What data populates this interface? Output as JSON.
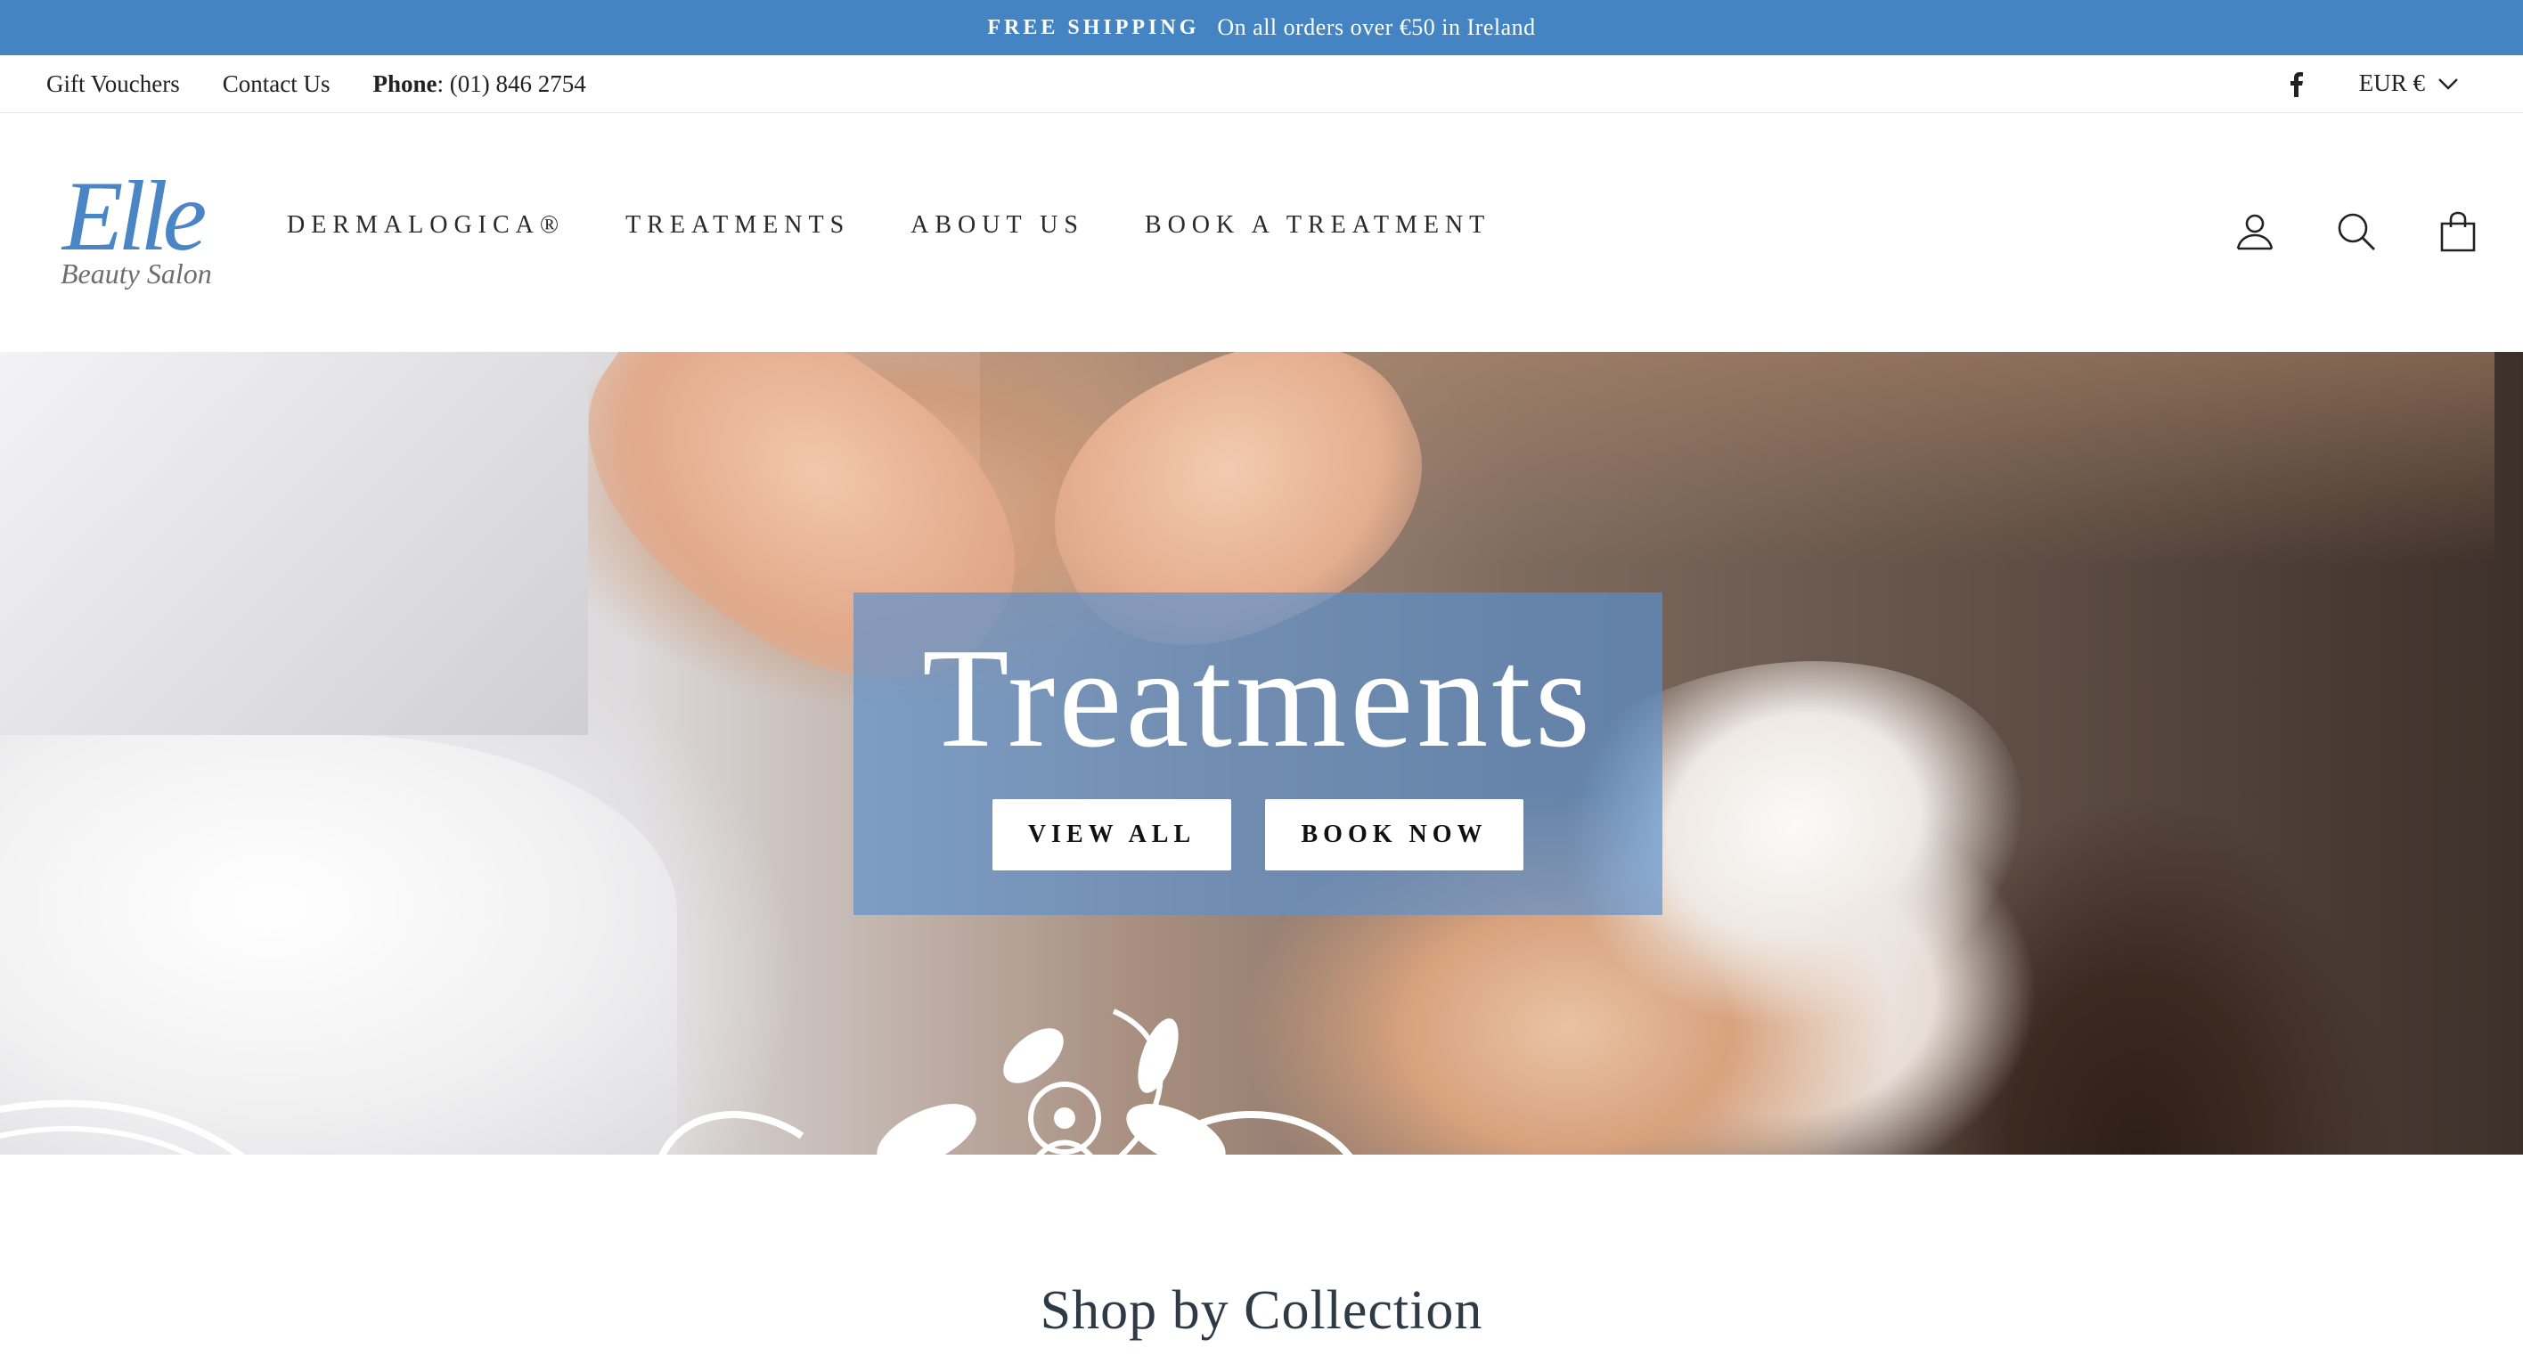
{
  "colors": {
    "accent": "#4484c2",
    "hero_overlay": "#5c91cd"
  },
  "announcement": {
    "strong": "FREE SHIPPING",
    "text": "On all orders over €50 in Ireland"
  },
  "utility": {
    "links": [
      "Gift Vouchers",
      "Contact Us"
    ],
    "phone_label": "Phone",
    "phone_value": ": (01) 846 2754",
    "social_icon": "facebook-icon",
    "currency": "EUR €"
  },
  "logo": {
    "script": "Elle",
    "subtitle": "Beauty Salon"
  },
  "nav": [
    "DERMALOGICA®",
    "TREATMENTS",
    "ABOUT US",
    "BOOK A TREATMENT"
  ],
  "header_icons": [
    "account-icon",
    "search-icon",
    "cart-icon"
  ],
  "hero": {
    "title": "Treatments",
    "buttons": {
      "view_all": "VIEW ALL",
      "book_now": "BOOK NOW"
    }
  },
  "section": {
    "title": "Shop by Collection"
  }
}
